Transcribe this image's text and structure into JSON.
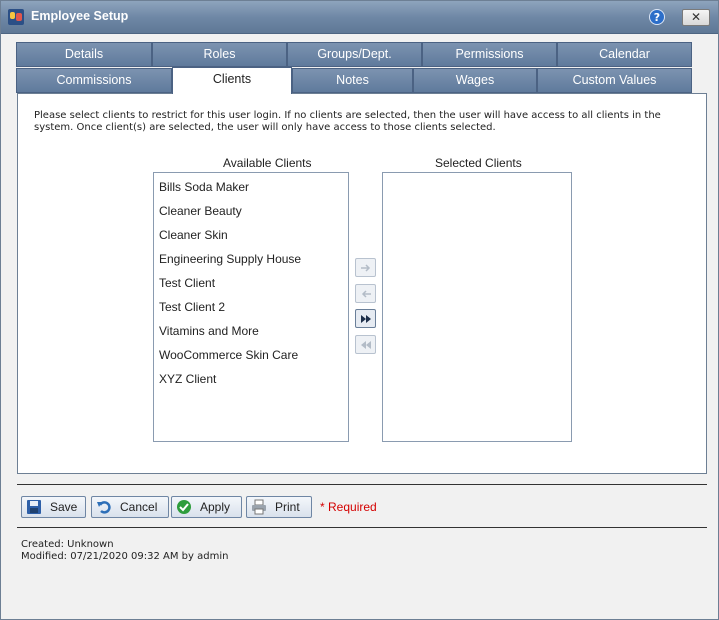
{
  "window": {
    "title": "Employee Setup",
    "help_icon_label": "?",
    "close_icon_label": "✕"
  },
  "tabs_row1": [
    "Details",
    "Roles",
    "Groups/Dept.",
    "Permissions",
    "Calendar"
  ],
  "tabs_row2": [
    "Commissions",
    "Clients",
    "Notes",
    "Wages",
    "Custom Values"
  ],
  "active_tab": "Clients",
  "instructions": "Please select clients to restrict for this user login. If no clients are selected, then the user will have access to all clients in the system. Once client(s) are selected, the user will only have access to those clients selected.",
  "available": {
    "header": "Available Clients",
    "items": [
      "Bills Soda Maker",
      "Cleaner Beauty",
      "Cleaner Skin",
      "Engineering Supply House",
      "Test Client",
      "Test Client 2",
      "Vitamins and More",
      "WooCommerce Skin Care",
      "XYZ Client"
    ]
  },
  "selected": {
    "header": "Selected Clients",
    "items": []
  },
  "actions": {
    "save": "Save",
    "cancel": "Cancel",
    "apply": "Apply",
    "print": "Print",
    "required": "* Required"
  },
  "meta": {
    "created": "Created:  Unknown",
    "modified": "Modified: 07/21/2020 09:32 AM by admin"
  }
}
